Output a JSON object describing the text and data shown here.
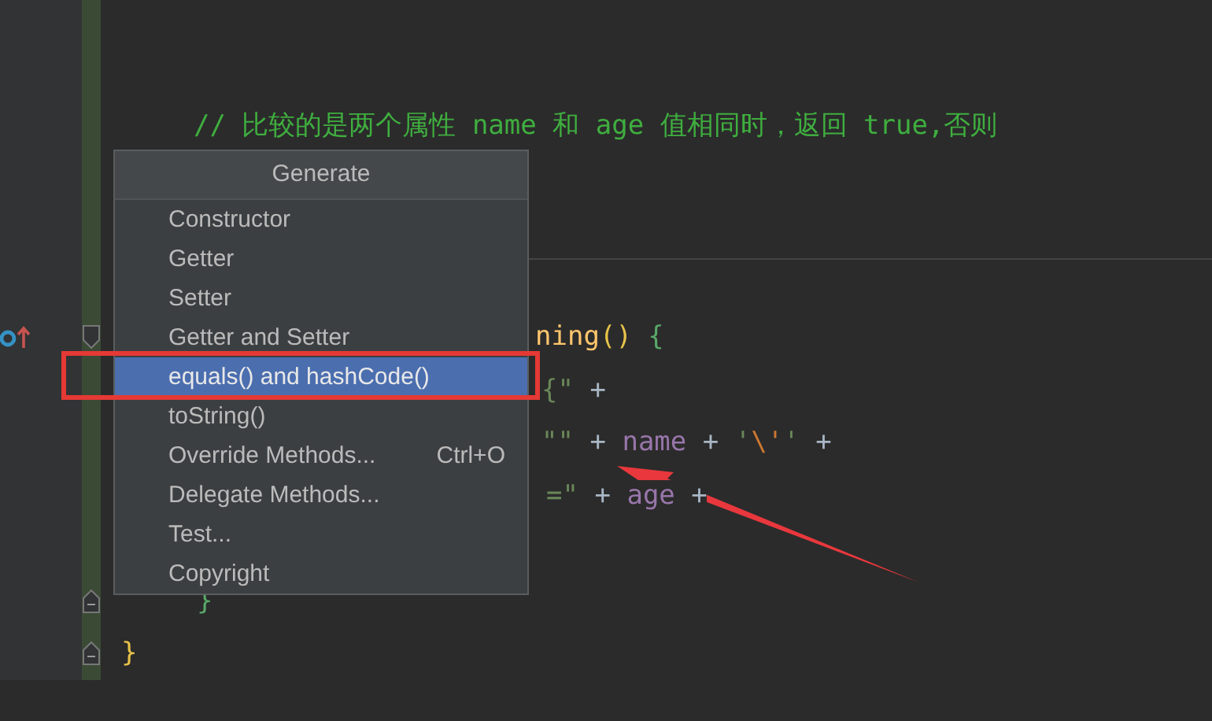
{
  "editor": {
    "lines": [
      {
        "tokens": [
          {
            "text": "// 比较的是两个属性 name 和 age 值相同时，返回 true,否则",
            "kind": "comment"
          }
        ]
      },
      {
        "method_separator": true
      },
      {
        "tokens": [
          {
            "text": "ning",
            "kind": "method"
          },
          {
            "text": "()",
            "kind": "bracket1"
          },
          {
            "text": " {",
            "kind": "bracket2"
          }
        ],
        "override_marker": true,
        "fold_marker": true
      },
      {
        "tokens": [
          {
            "text": "{\"",
            "kind": "string"
          },
          {
            "text": " +",
            "kind": "op"
          }
        ]
      },
      {
        "tokens": [
          {
            "text": "\"\"",
            "kind": "string"
          },
          {
            "text": " + ",
            "kind": "op"
          },
          {
            "text": "name",
            "kind": "field"
          },
          {
            "text": " + ",
            "kind": "op"
          },
          {
            "text": "'",
            "kind": "string"
          },
          {
            "text": "\\'",
            "kind": "escape"
          },
          {
            "text": "'",
            "kind": "string"
          },
          {
            "text": " +",
            "kind": "op"
          }
        ]
      },
      {
        "tokens": [
          {
            "text": "=\"",
            "kind": "string"
          },
          {
            "text": " + ",
            "kind": "op"
          },
          {
            "text": "age",
            "kind": "field"
          },
          {
            "text": " +",
            "kind": "op"
          }
        ]
      },
      {
        "tokens": [
          {
            "text": "}",
            "kind": "bracket2"
          }
        ],
        "fold_marker": true
      },
      {
        "tokens": [
          {
            "text": "}",
            "kind": "bracket1"
          }
        ],
        "fold_marker": true
      }
    ]
  },
  "popup": {
    "title": "Generate",
    "items": [
      {
        "label": "Constructor",
        "selected": false
      },
      {
        "label": "Getter",
        "selected": false
      },
      {
        "label": "Setter",
        "selected": false
      },
      {
        "label": "Getter and Setter",
        "selected": false
      },
      {
        "label": "equals() and hashCode()",
        "selected": true
      },
      {
        "label": "toString()",
        "selected": false
      },
      {
        "label": "Override Methods...",
        "shortcut": "Ctrl+O",
        "selected": false
      },
      {
        "label": "Delegate Methods...",
        "selected": false
      },
      {
        "label": "Test...",
        "selected": false
      },
      {
        "label": "Copyright",
        "selected": false
      }
    ]
  }
}
